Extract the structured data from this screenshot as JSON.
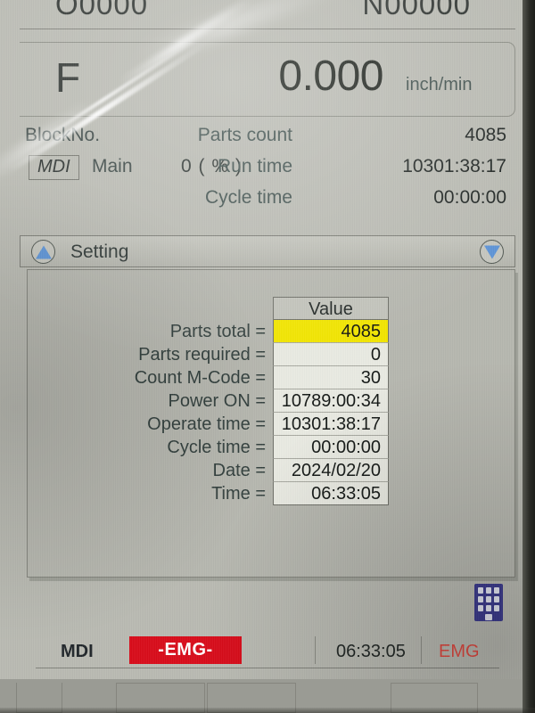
{
  "header": {
    "program_number": "O0000",
    "sequence_number": "N00000",
    "feed_label": "F",
    "feed_value": "0.000",
    "feed_unit": "inch/min"
  },
  "info": {
    "block_no_label": "BlockNo.",
    "mode_badge": "MDI",
    "program_scope": "Main",
    "override": "0 (      % )",
    "rows": [
      {
        "label": "Parts count",
        "value": "4085"
      },
      {
        "label": "Run time",
        "value": "10301:38:17"
      },
      {
        "label": "Cycle time",
        "value": "00:00:00"
      }
    ]
  },
  "panel": {
    "title": "Setting",
    "scroll_up_icon": "triangle-up-icon",
    "scroll_down_icon": "triangle-down-icon",
    "table": {
      "value_column_header": "Value",
      "highlight_color": "#f2e500",
      "rows": [
        {
          "label": "Parts total =",
          "value": "4085",
          "highlighted": true
        },
        {
          "label": "Parts required =",
          "value": "0",
          "highlighted": false
        },
        {
          "label": "Count M-Code =",
          "value": "30",
          "highlighted": false
        },
        {
          "label": "Power ON =",
          "value": "10789:00:34",
          "highlighted": false
        },
        {
          "label": "Operate time =",
          "value": "10301:38:17",
          "highlighted": false
        },
        {
          "label": "Cycle time =",
          "value": "00:00:00",
          "highlighted": false
        },
        {
          "label": "Date =",
          "value": "2024/02/20",
          "highlighted": false
        },
        {
          "label": "Time =",
          "value": "06:33:05",
          "highlighted": false
        }
      ]
    }
  },
  "keypad_button": {
    "icon": "keypad-icon",
    "color": "#3b3a8e"
  },
  "statusbar": {
    "mode": "MDI",
    "alarm_badge": "-EMG-",
    "alarm_badge_color": "#d80c1a",
    "clock": "06:33:05",
    "alarm_text": "EMG",
    "alarm_text_color": "#e0473f"
  }
}
